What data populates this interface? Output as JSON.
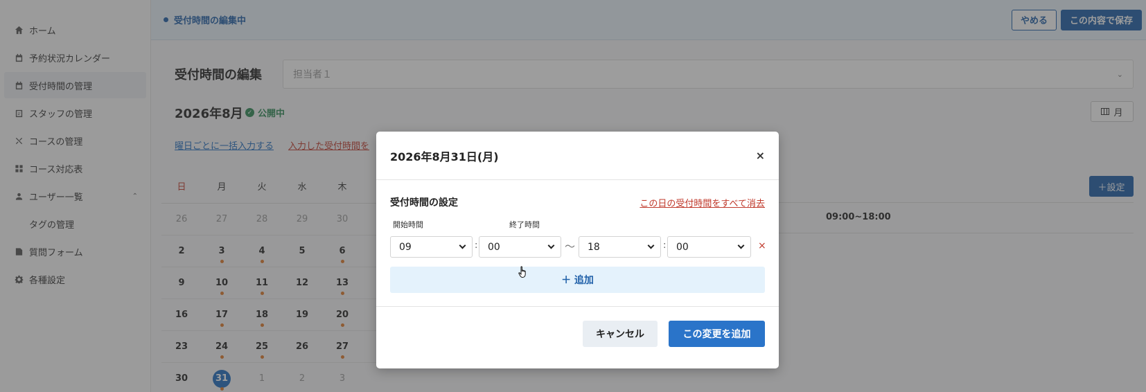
{
  "sidebar": {
    "items": [
      {
        "label": "ホーム",
        "icon": "home-icon"
      },
      {
        "label": "予約状況カレンダー",
        "icon": "calendar-icon"
      },
      {
        "label": "受付時間の管理",
        "icon": "calendar-icon",
        "active": true
      },
      {
        "label": "スタッフの管理",
        "icon": "staff-icon"
      },
      {
        "label": "コースの管理",
        "icon": "tools-icon"
      },
      {
        "label": "コース対応表",
        "icon": "grid-icon"
      },
      {
        "label": "ユーザー一覧",
        "icon": "user-icon",
        "expanded": true
      },
      {
        "label": "タグの管理",
        "sub": true
      },
      {
        "label": "質問フォーム",
        "icon": "form-icon"
      },
      {
        "label": "各種設定",
        "icon": "gear-icon"
      }
    ]
  },
  "topbar": {
    "status": "受付時間の編集中",
    "cancel_label": "やめる",
    "save_label": "この内容で保存"
  },
  "page": {
    "title": "受付時間の編集",
    "staff_placeholder": "担当者１",
    "month": "2026年8月",
    "published": "公開中",
    "view_label": "月",
    "bulk_link": "曜日ごとに一括入力する",
    "clear_link": "入力した受付時間を",
    "set_button": "＋設定",
    "time_range": "09:00~18:00"
  },
  "calendar": {
    "weekdays": [
      "日",
      "月",
      "火",
      "水",
      "木",
      "",
      ""
    ],
    "rows": [
      [
        {
          "d": "26",
          "m": true
        },
        {
          "d": "27",
          "m": true
        },
        {
          "d": "28",
          "m": true
        },
        {
          "d": "29",
          "m": true
        },
        {
          "d": "30",
          "m": true
        }
      ],
      [
        {
          "d": "2"
        },
        {
          "d": "3",
          "dot": true
        },
        {
          "d": "4",
          "dot": true
        },
        {
          "d": "5"
        },
        {
          "d": "6",
          "dot": true
        }
      ],
      [
        {
          "d": "9"
        },
        {
          "d": "10",
          "dot": true
        },
        {
          "d": "11",
          "dot": true
        },
        {
          "d": "12"
        },
        {
          "d": "13",
          "dot": true
        }
      ],
      [
        {
          "d": "16"
        },
        {
          "d": "17",
          "dot": true
        },
        {
          "d": "18",
          "dot": true
        },
        {
          "d": "19"
        },
        {
          "d": "20",
          "dot": true
        }
      ],
      [
        {
          "d": "23"
        },
        {
          "d": "24",
          "dot": true
        },
        {
          "d": "25",
          "dot": true
        },
        {
          "d": "26"
        },
        {
          "d": "27",
          "dot": true
        }
      ],
      [
        {
          "d": "30"
        },
        {
          "d": "31",
          "dot": true,
          "sel": true
        },
        {
          "d": "1",
          "m": true
        },
        {
          "d": "2",
          "m": true
        },
        {
          "d": "3",
          "m": true
        }
      ]
    ]
  },
  "modal": {
    "title": "2026年8月31日(月)",
    "close": "×",
    "section_title": "受付時間の設定",
    "clear_all": "この日の受付時間をすべて消去",
    "start_label": "開始時間",
    "end_label": "終了時間",
    "start_hour": "09",
    "start_min": "00",
    "end_hour": "18",
    "end_min": "00",
    "colon": ":",
    "tilde": "〜",
    "delete": "×",
    "add_label": "＋ 追加",
    "cancel_label": "キャンセル",
    "apply_label": "この変更を追加"
  },
  "colors": {
    "primary": "#1e5fa8",
    "accent_blue": "#2a74c9",
    "danger": "#c0392b",
    "success": "#2e8b57",
    "dot": "#e07b2a"
  }
}
